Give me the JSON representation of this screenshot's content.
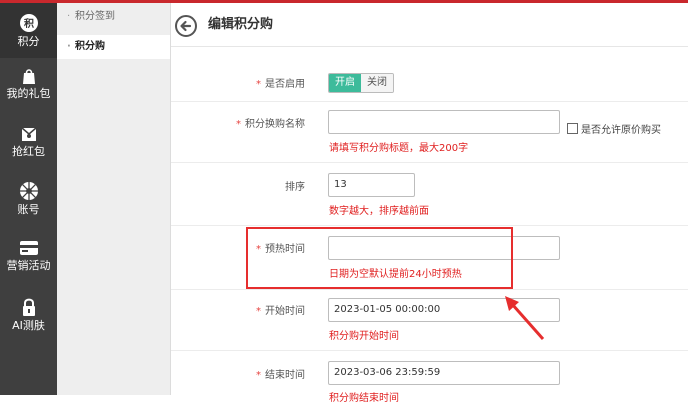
{
  "nav": {
    "items": [
      {
        "label": "积分",
        "icon": "points-badge-icon"
      },
      {
        "label": "我的礼包",
        "icon": "gift-bag-icon"
      },
      {
        "label": "抢红包",
        "icon": "red-envelope-icon"
      },
      {
        "label": "账号",
        "icon": "aperture-icon"
      },
      {
        "label": "营销活动",
        "icon": "card-icon"
      },
      {
        "label": "AI测肤",
        "icon": "lock-icon"
      }
    ]
  },
  "subnav": {
    "items": [
      {
        "label": "积分签到"
      },
      {
        "label": "积分购"
      }
    ]
  },
  "page": {
    "title": "编辑积分购"
  },
  "form": {
    "enable_label": "是否启用",
    "enable_on": "开启",
    "enable_off": "关闭",
    "name_label": "积分换购名称",
    "name_value": "",
    "name_hint": "请填写积分购标题，最大200字",
    "allow_original_label": "是否允许原价购买",
    "sort_label": "排序",
    "sort_value": "13",
    "sort_hint": "数字越大，排序越前面",
    "preheat_label": "预热时间",
    "preheat_value": "",
    "preheat_hint": "日期为空默认提前24小时预热",
    "start_label": "开始时间",
    "start_value": "2023-01-05 00:00:00",
    "start_hint": "积分购开始时间",
    "end_label": "结束时间",
    "end_value": "2023-03-06 23:59:59",
    "end_hint": "积分购结束时间"
  },
  "colors": {
    "accent_red": "#c9282d",
    "toggle_on": "#3dbb9b",
    "hint_red": "#e02020",
    "nav_bg": "#3f3f3f"
  }
}
